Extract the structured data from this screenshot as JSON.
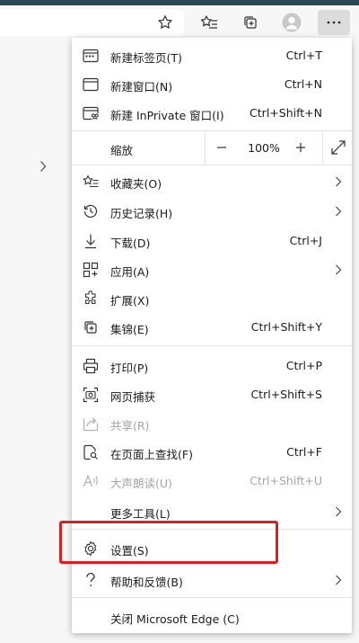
{
  "toolbar": {
    "icons": [
      "favorite-star-icon",
      "favorites-list-icon",
      "collections-icon",
      "profile-avatar-icon",
      "more-menu-icon"
    ]
  },
  "menu": {
    "new_tab": {
      "label": "新建标签页(T)",
      "shortcut": "Ctrl+T"
    },
    "new_window": {
      "label": "新建窗口(N)",
      "shortcut": "Ctrl+N"
    },
    "new_private": {
      "label": "新建 InPrivate 窗口(I)",
      "shortcut": "Ctrl+Shift+N"
    },
    "zoom": {
      "label": "缩放",
      "value": "100%",
      "minus": "—",
      "plus": "+"
    },
    "favorites": {
      "label": "收藏夹(O)"
    },
    "history": {
      "label": "历史记录(H)"
    },
    "downloads": {
      "label": "下载(D)",
      "shortcut": "Ctrl+J"
    },
    "apps": {
      "label": "应用(A)"
    },
    "extensions": {
      "label": "扩展(X)"
    },
    "collections": {
      "label": "集锦(E)",
      "shortcut": "Ctrl+Shift+Y"
    },
    "print": {
      "label": "打印(P)",
      "shortcut": "Ctrl+P"
    },
    "web_capture": {
      "label": "网页捕获",
      "shortcut": "Ctrl+Shift+S"
    },
    "share": {
      "label": "共享(R)"
    },
    "find": {
      "label": "在页面上查找(F)",
      "shortcut": "Ctrl+F"
    },
    "read_aloud": {
      "label": "大声朗读(U)",
      "shortcut": "Ctrl+Shift+U"
    },
    "more_tools": {
      "label": "更多工具(L)"
    },
    "settings": {
      "label": "设置(S)"
    },
    "help": {
      "label": "帮助和反馈(B)"
    },
    "close_edge": {
      "label": "关闭 Microsoft Edge (C)"
    }
  },
  "colors": {
    "highlight_border": "#e01e1e",
    "top_strip": "#2c4a55",
    "disabled_text": "#a6a6a6"
  }
}
